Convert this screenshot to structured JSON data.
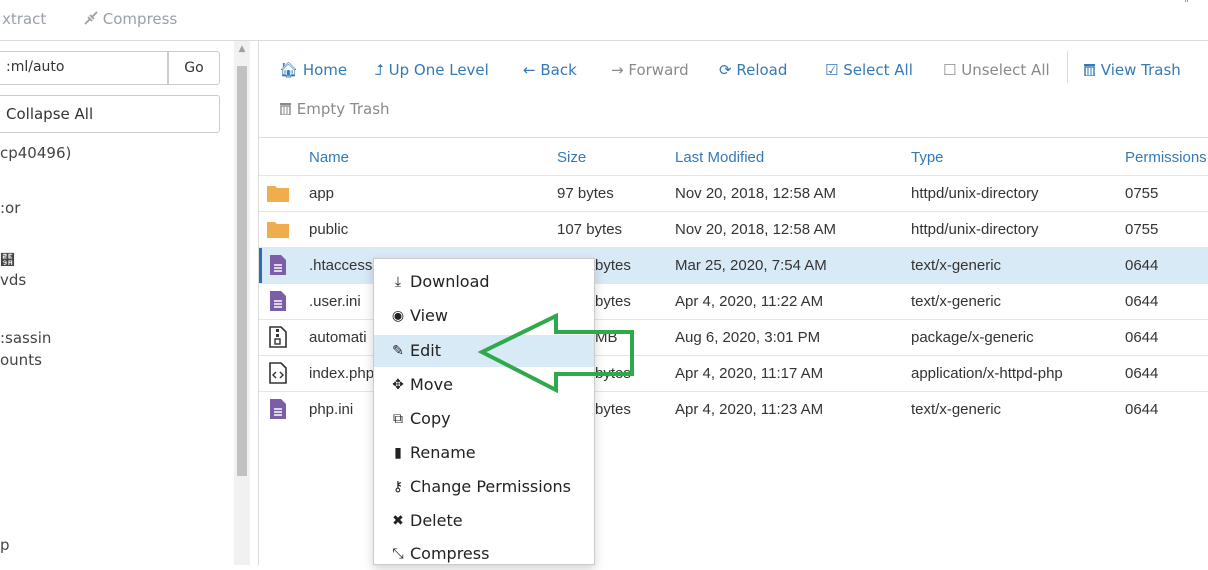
{
  "top_toolbar": {
    "extract_label": "xtract",
    "compress_label": "Compress"
  },
  "left_panel": {
    "path_value": ":ml/auto",
    "go_label": "Go",
    "collapse_label": "Collapse All",
    "tree_items": [
      "cp40496)",
      ":or",
      "⺚",
      "vds",
      ":sassin",
      "ounts",
      "p"
    ]
  },
  "nav": {
    "home": "Home",
    "up_one_level": "Up One Level",
    "back": "Back",
    "forward": "Forward",
    "reload": "Reload",
    "select_all": "Select All",
    "unselect_all": "Unselect All",
    "view_trash": "View Trash",
    "empty_trash": "Empty Trash"
  },
  "table": {
    "headers": {
      "name": "Name",
      "size": "Size",
      "modified": "Last Modified",
      "type": "Type",
      "permissions": "Permissions"
    },
    "rows": [
      {
        "name": "app",
        "size": "97 bytes",
        "modified": "Nov 20, 2018, 12:58 AM",
        "type": "httpd/unix-directory",
        "perm": "0755"
      },
      {
        "name": "public",
        "size": "107 bytes",
        "modified": "Nov 20, 2018, 12:58 AM",
        "type": "httpd/unix-directory",
        "perm": "0755"
      },
      {
        "name": ".htaccess",
        "size": "bytes",
        "modified": "Mar 25, 2020, 7:54 AM",
        "type": "text/x-generic",
        "perm": "0644"
      },
      {
        "name": ".user.ini",
        "size": "bytes",
        "modified": "Apr 4, 2020, 11:22 AM",
        "type": "text/x-generic",
        "perm": "0644"
      },
      {
        "name": "automati",
        "size": "MB",
        "modified": "Aug 6, 2020, 3:01 PM",
        "type": "package/x-generic",
        "perm": "0644"
      },
      {
        "name": "index.php",
        "size": "bytes",
        "modified": "Apr 4, 2020, 11:17 AM",
        "type": "application/x-httpd-php",
        "perm": "0644"
      },
      {
        "name": "php.ini",
        "size": "bytes",
        "modified": "Apr 4, 2020, 11:23 AM",
        "type": "text/x-generic",
        "perm": "0644"
      }
    ]
  },
  "context_menu": {
    "items": [
      "Download",
      "View",
      "Edit",
      "Move",
      "Copy",
      "Rename",
      "Change Permissions",
      "Delete",
      "Compress"
    ]
  },
  "corner_mark": "¨",
  "colors": {
    "link": "#337ab7",
    "selected_row": "#d9eaf7",
    "folder": "#f0ad4e",
    "file": "#7a5ea8",
    "arrow": "#2eaa4a"
  }
}
